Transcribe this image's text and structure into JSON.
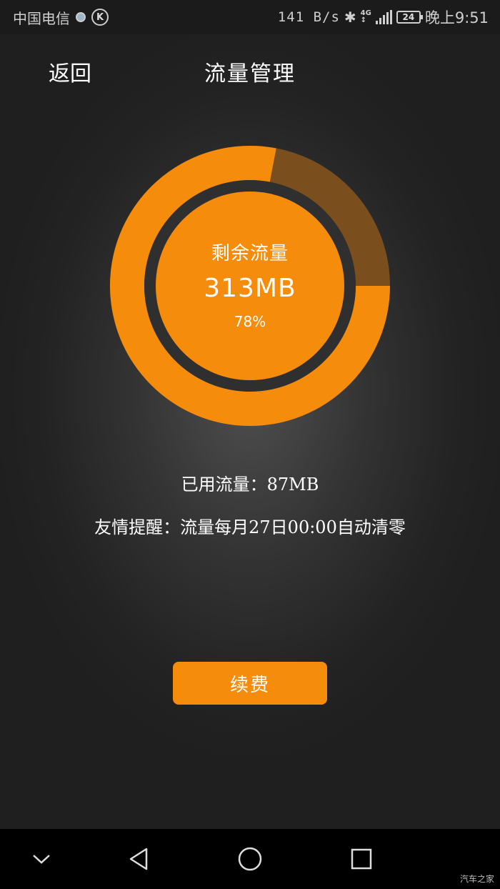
{
  "status_bar": {
    "carrier": "中国电信",
    "net_speed": "141 B/s",
    "network": "4G",
    "battery": "24",
    "time": "晚上9:51"
  },
  "header": {
    "back_label": "返回",
    "title": "流量管理"
  },
  "gauge": {
    "label": "剩余流量",
    "value": "313MB",
    "percent_text": "78%",
    "remaining_fraction": 0.78
  },
  "usage": {
    "used_text": "已用流量：87MB",
    "notice_text": "友情提醒：流量每月27日00:00自动清零"
  },
  "actions": {
    "renew_label": "续费"
  },
  "watermark": "汽车之家",
  "colors": {
    "accent": "#f68c0c",
    "used_arc": "#7a4e1d",
    "ring_gap": "#2f2f2f"
  }
}
